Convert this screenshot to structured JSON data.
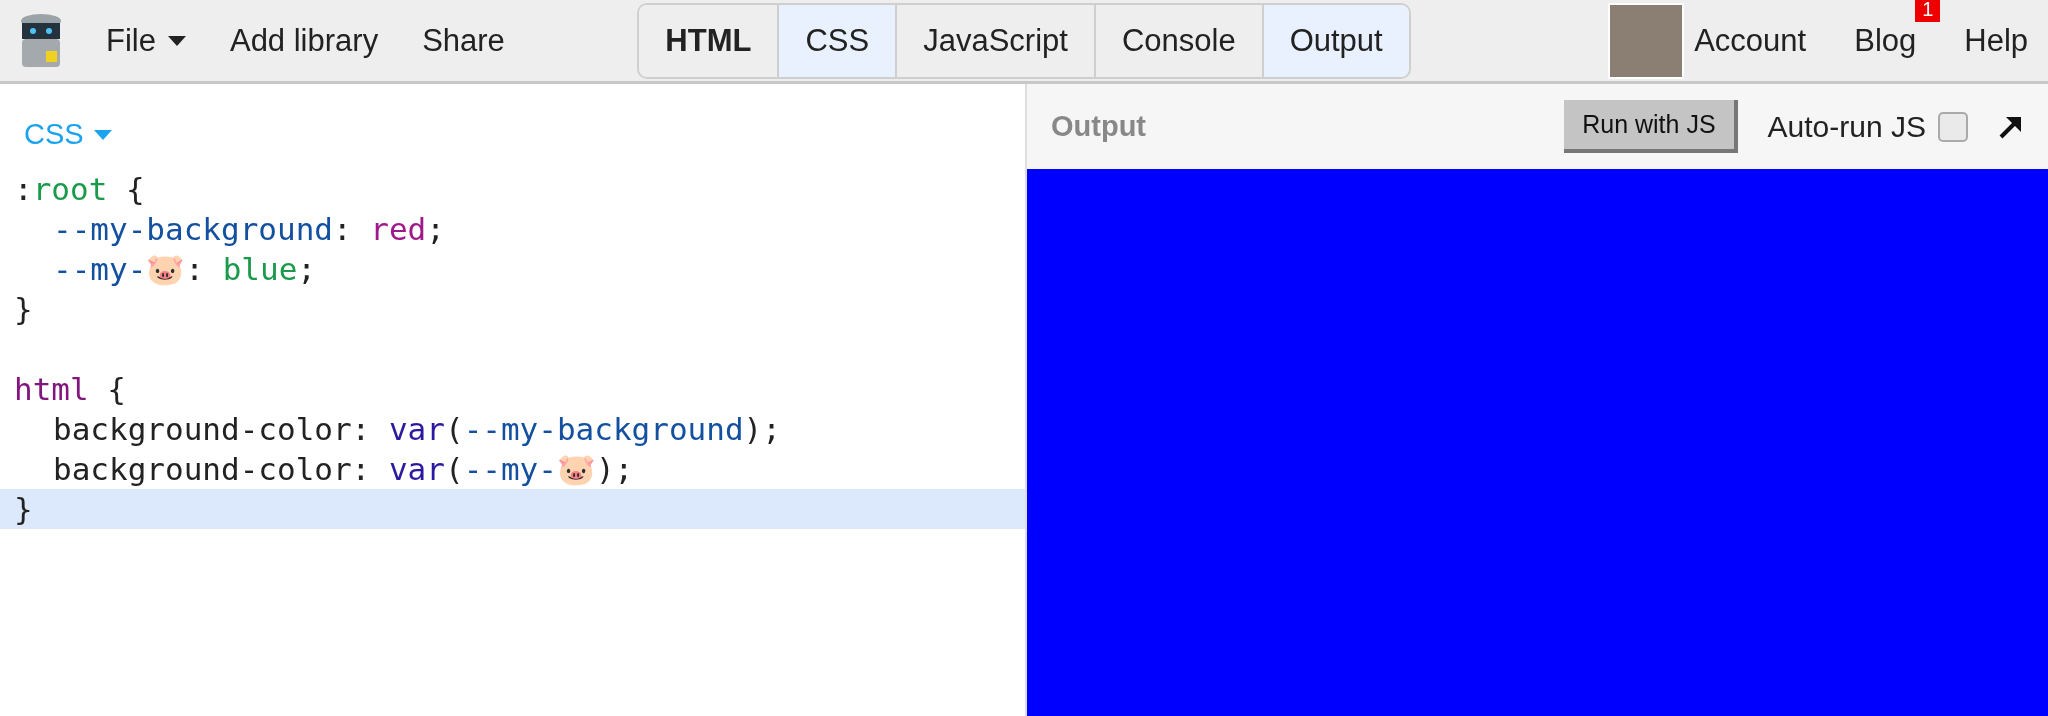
{
  "menu": [
    {
      "label": "File",
      "dropdown": true
    },
    {
      "label": "Add library",
      "dropdown": false
    },
    {
      "label": "Share",
      "dropdown": false
    }
  ],
  "tabs": [
    {
      "label": "HTML",
      "selected": false,
      "bold": true
    },
    {
      "label": "CSS",
      "selected": true,
      "bold": false
    },
    {
      "label": "JavaScript",
      "selected": false,
      "bold": false
    },
    {
      "label": "Console",
      "selected": false,
      "bold": false
    },
    {
      "label": "Output",
      "selected": true,
      "bold": false
    }
  ],
  "account": {
    "label": "Account"
  },
  "links": [
    {
      "label": "Blog",
      "badge": "1"
    },
    {
      "label": "Help"
    }
  ],
  "editor": {
    "language": "CSS",
    "lines": [
      {
        "current": false,
        "indent": false,
        "tokens": [
          {
            "text": ":",
            "kind": "plain"
          },
          {
            "text": "root",
            "kind": "selector"
          },
          {
            "text": " {",
            "kind": "plain"
          }
        ]
      },
      {
        "current": false,
        "indent": true,
        "tokens": [
          {
            "text": "--my-background",
            "kind": "variable"
          },
          {
            "text": ": ",
            "kind": "plain"
          },
          {
            "text": "red",
            "kind": "keyword"
          },
          {
            "text": ";",
            "kind": "plain"
          }
        ]
      },
      {
        "current": false,
        "indent": true,
        "tokens": [
          {
            "text": "--my-🐷",
            "kind": "variable"
          },
          {
            "text": ": ",
            "kind": "plain"
          },
          {
            "text": "blue",
            "kind": "selector"
          },
          {
            "text": ";",
            "kind": "plain"
          }
        ]
      },
      {
        "current": false,
        "indent": false,
        "tokens": [
          {
            "text": "}",
            "kind": "plain"
          }
        ]
      },
      {
        "current": false
      },
      {
        "current": false,
        "indent": false,
        "tokens": [
          {
            "text": "html",
            "kind": "tag"
          },
          {
            "text": " {",
            "kind": "plain"
          }
        ]
      },
      {
        "current": false,
        "indent": true,
        "tokens": [
          {
            "text": "background-color: ",
            "kind": "plain"
          },
          {
            "text": "var",
            "kind": "function"
          },
          {
            "text": "(",
            "kind": "plain"
          },
          {
            "text": "--my-background",
            "kind": "variable"
          },
          {
            "text": ");",
            "kind": "plain"
          }
        ]
      },
      {
        "current": false,
        "indent": true,
        "tokens": [
          {
            "text": "background-color: ",
            "kind": "plain"
          },
          {
            "text": "var",
            "kind": "function"
          },
          {
            "text": "(",
            "kind": "plain"
          },
          {
            "text": "--my-🐷",
            "kind": "variable"
          },
          {
            "text": ");",
            "kind": "plain"
          }
        ]
      },
      {
        "current": true,
        "indent": false,
        "tokens": [
          {
            "text": "}",
            "kind": "plain"
          }
        ]
      }
    ]
  },
  "output": {
    "title": "Output",
    "run_button": "Run with JS",
    "autorun": {
      "label": "Auto-run JS",
      "checked": false
    }
  }
}
